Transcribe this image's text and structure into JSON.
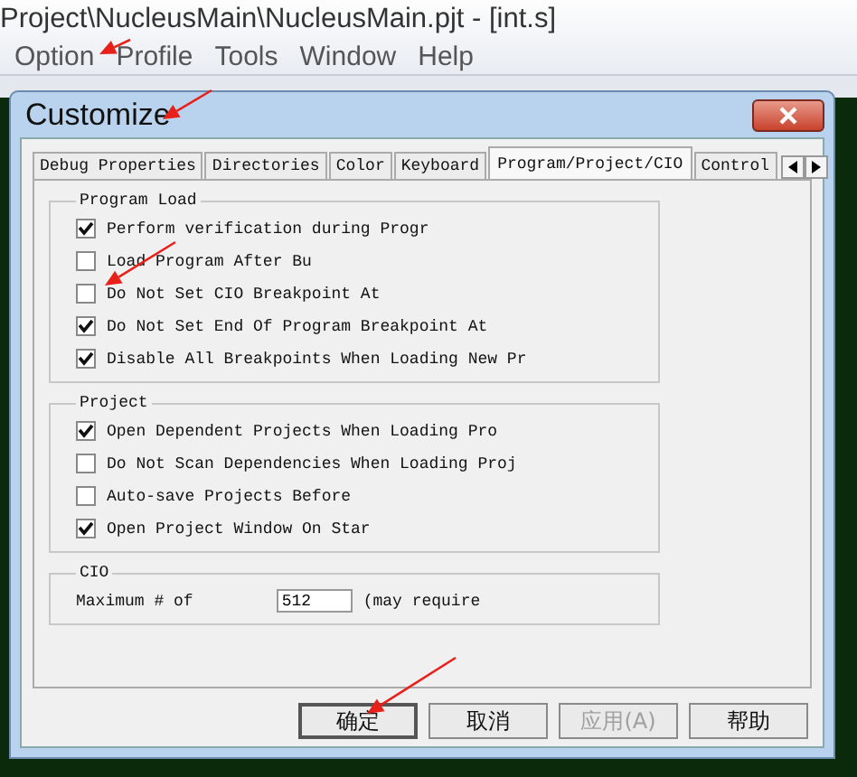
{
  "app": {
    "title": "Project\\NucleusMain\\NucleusMain.pjt  - [int.s]",
    "menu": [
      {
        "label": "Option"
      },
      {
        "label": "Profile"
      },
      {
        "label": "Tools"
      },
      {
        "label": "Window"
      },
      {
        "label": "Help"
      }
    ]
  },
  "dialog": {
    "title": "Customize",
    "tabs": [
      {
        "label": "Debug Properties",
        "selected": false
      },
      {
        "label": "Directories",
        "selected": false
      },
      {
        "label": "Color",
        "selected": false
      },
      {
        "label": "Keyboard",
        "selected": false
      },
      {
        "label": "Program/Project/CIO",
        "selected": true
      },
      {
        "label": "Control",
        "selected": false
      }
    ],
    "groups": [
      {
        "title": "Program Load",
        "options": [
          {
            "label": "Perform verification during Progr",
            "checked": true
          },
          {
            "label": "Load Program After Bu",
            "checked": false
          },
          {
            "label": "Do Not Set CIO Breakpoint At",
            "checked": false
          },
          {
            "label": "Do Not Set End Of Program Breakpoint At",
            "checked": true
          },
          {
            "label": "Disable All Breakpoints When Loading New Pr",
            "checked": true
          }
        ]
      },
      {
        "title": "Project",
        "options": [
          {
            "label": "Open Dependent Projects When Loading Pro",
            "checked": true
          },
          {
            "label": "Do Not Scan Dependencies When Loading Proj",
            "checked": false
          },
          {
            "label": "Auto-save Projects Before",
            "checked": false
          },
          {
            "label": "Open Project Window On Star",
            "checked": true
          }
        ]
      },
      {
        "title": "CIO",
        "fields": [
          {
            "label": "Maximum # of",
            "value": "512",
            "note": "(may require"
          }
        ]
      }
    ],
    "buttons": [
      {
        "label": "确定",
        "default": true,
        "disabled": false
      },
      {
        "label": "取消",
        "default": false,
        "disabled": false
      },
      {
        "label": "应用(A)",
        "default": false,
        "disabled": true
      },
      {
        "label": "帮助",
        "default": false,
        "disabled": false
      }
    ]
  }
}
